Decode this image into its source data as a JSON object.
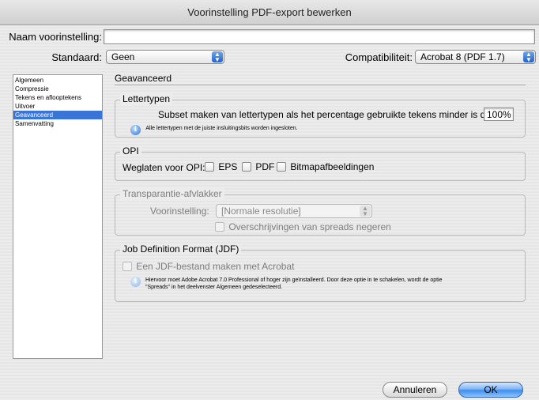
{
  "window": {
    "title": "Voorinstelling PDF-export bewerken"
  },
  "preset": {
    "name_label": "Naam voorinstelling:",
    "name_value": ""
  },
  "standard": {
    "label": "Standaard:",
    "value": "Geen"
  },
  "compat": {
    "label": "Compatibiliteit:",
    "value": "Acrobat 8 (PDF 1.7)"
  },
  "sidebar": {
    "items": [
      {
        "label": "Algemeen"
      },
      {
        "label": "Compressie"
      },
      {
        "label": "Tekens en aflooptekens"
      },
      {
        "label": "Uitvoer"
      },
      {
        "label": "Geavanceerd"
      },
      {
        "label": "Samenvatting"
      }
    ],
    "selected_index": 4
  },
  "section": {
    "title": "Geavanceerd"
  },
  "fonts": {
    "title": "Lettertypen",
    "subset_label": "Subset maken van lettertypen als het percentage gebruikte tekens minder is dan:",
    "subset_value": "100%",
    "info": "Alle lettertypen met de juiste insluitingsbits worden ingesloten."
  },
  "opi": {
    "title": "OPI",
    "omit_label": "Weglaten voor OPI:",
    "eps": "EPS",
    "pdf": "PDF",
    "bitmap": "Bitmapafbeeldingen"
  },
  "flattener": {
    "title": "Transparantie-afvlakker",
    "preset_label": "Voorinstelling:",
    "preset_value": "[Normale resolutie]",
    "ignore_label": "Overschrijvingen van spreads negeren"
  },
  "jdf": {
    "title": "Job Definition Format (JDF)",
    "create_label": "Een JDF-bestand maken met Acrobat",
    "info_line1": "Hiervoor moet Adobe Acrobat 7.0 Professional of hoger zijn geïnstalleerd. Door deze optie in te schakelen, wordt de optie",
    "info_line2": "\"Spreads\" in het deelvenster Algemeen gedeselecteerd."
  },
  "buttons": {
    "cancel": "Annuleren",
    "ok": "OK"
  }
}
